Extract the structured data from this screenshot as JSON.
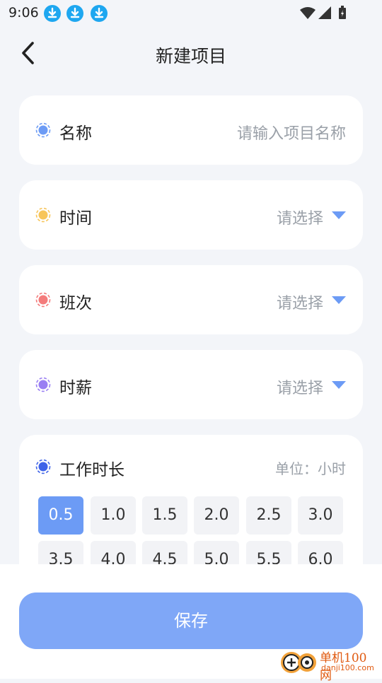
{
  "status_bar": {
    "time": "9:06",
    "download_icons": [
      "download-icon",
      "download-icon",
      "download-icon"
    ],
    "right_icons": [
      "wifi-icon",
      "signal-icon",
      "battery-icon"
    ]
  },
  "header": {
    "title": "新建项目",
    "back_icon": "chevron-left-icon"
  },
  "form": {
    "name": {
      "label": "名称",
      "placeholder": "请输入项目名称",
      "dot_color": "#6c9bf5"
    },
    "time": {
      "label": "时间",
      "value": "请选择",
      "dot_color": "#f7c55a"
    },
    "shift": {
      "label": "班次",
      "value": "请选择",
      "dot_color": "#f47b7b"
    },
    "wage": {
      "label": "时薪",
      "value": "请选择",
      "dot_color": "#9a7ff3"
    }
  },
  "duration": {
    "title": "工作时长",
    "unit": "单位：小时",
    "dot_color": "#3f63e8",
    "selected": "0.5",
    "options": [
      "0.5",
      "1.0",
      "1.5",
      "2.0",
      "2.5",
      "3.0",
      "3.5",
      "4.0",
      "4.5",
      "5.0",
      "5.5",
      "6.0"
    ]
  },
  "save_button": {
    "label": "保存"
  },
  "watermark": {
    "name": "单机100网",
    "url": "danji100.com"
  },
  "colors": {
    "accent": "#6c9bf5",
    "save_button": "#7fa7f7",
    "dropdown_arrow": "#6c9bf5",
    "placeholder": "#9aa0a8",
    "background": "#f3f5f9"
  }
}
